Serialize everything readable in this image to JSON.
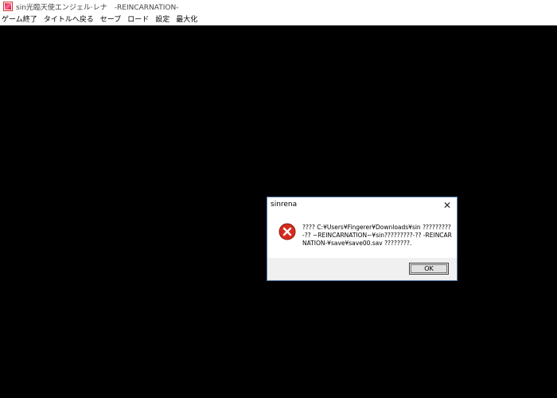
{
  "window": {
    "title": "sin光臨天使エンジェル·レナ　-REINCARNATION-",
    "icon": "app-icon"
  },
  "menubar": {
    "items": [
      {
        "id": "quit",
        "label": "ゲーム終了"
      },
      {
        "id": "title",
        "label": "タイトルへ戻る"
      },
      {
        "id": "save",
        "label": "セーブ"
      },
      {
        "id": "load",
        "label": "ロード"
      },
      {
        "id": "settings",
        "label": "設定"
      },
      {
        "id": "maximize",
        "label": "最大化"
      }
    ]
  },
  "dialog": {
    "title": "sinrena",
    "close_glyph": "✕",
    "icon": "error-icon",
    "message": "???? C:¥Users¥Fingerer¥Downloads¥sin ?????????-?? ~REINCARNATION~¥sin?????????-?? -REINCARNATION-¥save¥save00.sav ????????.",
    "ok_label": "OK"
  },
  "colors": {
    "background": "#000000",
    "dialog_border": "#5a7fb0",
    "error_red": "#d52b1e",
    "footer": "#f0f0f0"
  }
}
